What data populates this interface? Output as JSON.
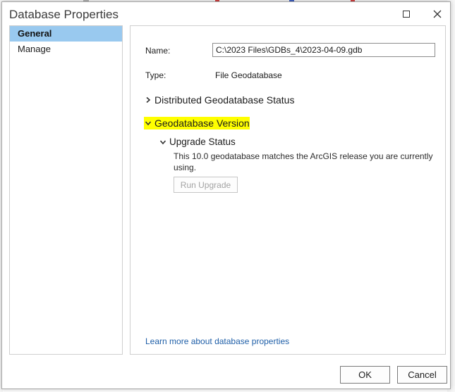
{
  "dialog": {
    "title": "Database Properties"
  },
  "nav": {
    "items": [
      {
        "label": "General",
        "selected": true
      },
      {
        "label": "Manage",
        "selected": false
      }
    ]
  },
  "general": {
    "name_label": "Name:",
    "name_value": "C:\\2023 Files\\GDBs_4\\2023-04-09.gdb",
    "type_label": "Type:",
    "type_value": "File Geodatabase",
    "distributed_status_title": "Distributed Geodatabase Status",
    "version_title": "Geodatabase Version",
    "upgrade_status_title": "Upgrade Status",
    "upgrade_message": "This 10.0 geodatabase matches the ArcGIS release you are currently using.",
    "run_upgrade_label": "Run Upgrade",
    "learn_more_link": "Learn more about database properties"
  },
  "footer": {
    "ok_label": "OK",
    "cancel_label": "Cancel"
  },
  "colors": {
    "selection": "#99c9ef",
    "highlight": "#ffff00",
    "link": "#1f5fa8"
  },
  "icons": {
    "close": "close-icon",
    "maximize": "maximize-icon",
    "collapsed": "chevron-right-icon",
    "expanded": "chevron-down-icon"
  }
}
